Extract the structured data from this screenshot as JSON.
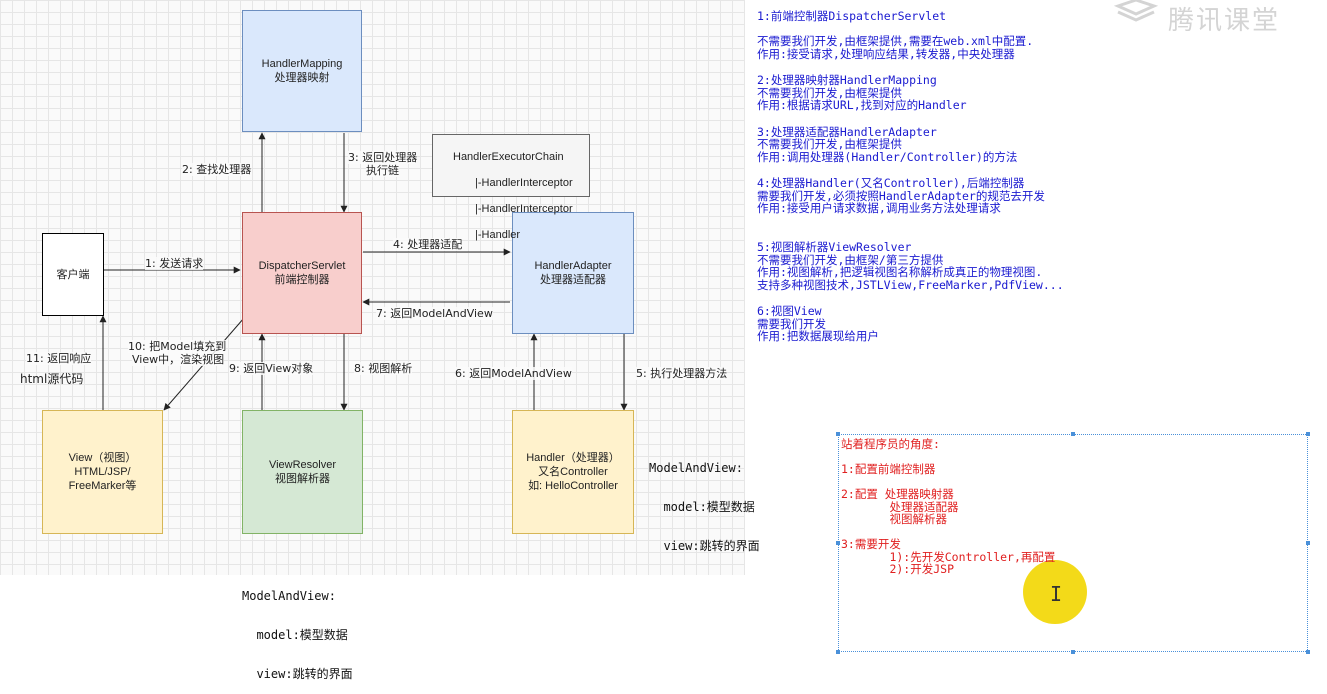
{
  "watermark": "腾讯课堂",
  "diagram": {
    "boxes": {
      "handler_mapping": "HandlerMapping\n处理器映射",
      "dispatcher": "DispatcherServlet\n前端控制器",
      "client": "客户端",
      "handler_adapter": "HandlerAdapter\n处理器适配器",
      "view": "View（视图）\nHTML/JSP/\nFreeMarker等",
      "view_resolver": "ViewResolver\n视图解析器",
      "handler": "Handler（处理器）\n又名Controller\n如: HelloController",
      "chain_title": "HandlerExecutorChain",
      "chain_item1": "|-HandlerInterceptor",
      "chain_item2": "|-HandlerInterceptor",
      "chain_item3": "|-Handler"
    },
    "labels": {
      "step1": "1: 发送请求",
      "step2": "2: 查找处理器",
      "step3a": "3: 返回处理器",
      "step3b": "执行链",
      "step4": "4: 处理器适配",
      "step5": "5: 执行处理器方法",
      "step6": "6: 返回ModelAndView",
      "step7": "7: 返回ModelAndView",
      "step8": "8: 视图解析",
      "step9": "9: 返回View对象",
      "step10a": "10: 把Model填充到",
      "step10b": "View中，渲染视图",
      "step11": "11: 返回响应",
      "html_src": "html源代码"
    },
    "mav_right": [
      "ModelAndView:",
      "  model:模型数据",
      "  view:跳转的界面"
    ],
    "mav_bottom": [
      "ModelAndView:",
      "  model:模型数据",
      "  view:跳转的界面"
    ]
  },
  "notes": [
    [
      "1:前端控制器DispatcherServlet",
      "",
      "不需要我们开发,由框架提供,需要在web.xml中配置.",
      "作用:接受请求,处理响应结果,转发器,中央处理器"
    ],
    [
      "2:处理器映射器HandlerMapping",
      "不需要我们开发,由框架提供",
      "作用:根据请求URL,找到对应的Handler"
    ],
    [
      "3:处理器适配器HandlerAdapter",
      "不需要我们开发,由框架提供",
      "作用:调用处理器(Handler/Controller)的方法"
    ],
    [
      "4:处理器Handler(又名Controller),后端控制器",
      "需要我们开发,必须按照HandlerAdapter的规范去开发",
      "作用:接受用户请求数据,调用业务方法处理请求"
    ],
    [
      "",
      "5:视图解析器ViewResolver",
      "不需要我们开发,由框架/第三方提供",
      "作用:视图解析,把逻辑视图名称解析成真正的物理视图.",
      "支持多种视图技术,JSTLView,FreeMarker,PdfView..."
    ],
    [
      "6:视图View",
      "需要我们开发",
      "作用:把数据展现给用户"
    ]
  ],
  "developer_notes": [
    "站着程序员的角度:",
    "",
    "1:配置前端控制器",
    "",
    "2:配置 处理器映射器",
    "       处理器适配器",
    "       视图解析器",
    "",
    "3:需要开发",
    "       1):先开发Controller,再配置",
    "       2):开发JSP"
  ],
  "colors": {
    "blue_box": "#dae8fc",
    "red_box": "#f8cecc",
    "green_box": "#d5e8d4",
    "yellow_box": "#fff2cc",
    "notes_text": "#1a1ad0",
    "dev_text": "#e02020",
    "cursor_highlight": "#f2d600"
  }
}
